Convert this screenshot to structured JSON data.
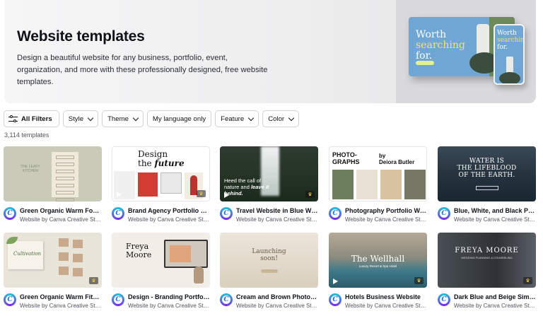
{
  "hero": {
    "title": "Website templates",
    "description": "Design a beautiful website for any business, portfolio, event, organization, and more with these professionally designed, free website templates.",
    "mock_headline_line1": "Worth",
    "mock_headline_line2": "searching",
    "mock_headline_line3": "for."
  },
  "filters": {
    "all_label": "All Filters",
    "style": "Style",
    "theme": "Theme",
    "language": "My language only",
    "feature": "Feature",
    "color": "Color"
  },
  "result_count": "3,114 templates",
  "templates": [
    {
      "title": "Green Organic Warm Food ...",
      "author": "Website by Canva Creative Stud...",
      "thumb_text": "THE LEAFY KITCHEN",
      "premium": false,
      "video": false
    },
    {
      "title": "Brand Agency Portfolio W...",
      "author": "Website by Canva Creative Stud...",
      "thumb_text_1": "Design",
      "thumb_text_2": "the",
      "thumb_text_3": "future",
      "premium": true,
      "video": true
    },
    {
      "title": "Travel Website in Blue Whi...",
      "author": "Website by Canva Creative Stud...",
      "thumb_text_1": "Heed the call of",
      "thumb_text_2": "nature and",
      "thumb_text_3": "leave it",
      "thumb_text_4": "behind.",
      "premium": true,
      "video": true
    },
    {
      "title": "Photography Portfolio We...",
      "author": "Website by Canva Creative Stud...",
      "thumb_text_1": "PHOTO-",
      "thumb_text_2": "GRAPHS",
      "thumb_text_3": "by",
      "thumb_text_4": "Deiora Butler",
      "premium": false,
      "video": false
    },
    {
      "title": "Blue, White, and Black Pho...",
      "author": "Website by Canva Creative Stud...",
      "thumb_text_1": "WATER IS",
      "thumb_text_2": "THE LIFEBLOOD",
      "thumb_text_3": "OF THE EARTH.",
      "premium": false,
      "video": false
    },
    {
      "title": "Green Organic Warm Fitne...",
      "author": "Website by Canva Creative Stud...",
      "thumb_text": "Cultivation",
      "premium": true,
      "video": false
    },
    {
      "title": "Design - Branding Portfoli...",
      "author": "Website by Canva Creative Stud...",
      "thumb_text_1": "Freya",
      "thumb_text_2": "Moore",
      "premium": false,
      "video": false
    },
    {
      "title": "Cream and Brown Photogr...",
      "author": "Website by Canva Creative Stud...",
      "thumb_text_1": "Launching",
      "thumb_text_2": "soon!",
      "premium": false,
      "video": false
    },
    {
      "title": "Hotels Business Website",
      "author": "Website by Canva Creative Stud...",
      "thumb_text_1": "The Wellhall",
      "thumb_text_2": "Luxury Resort & Spa Hotel",
      "premium": true,
      "video": true
    },
    {
      "title": "Dark Blue and Beige Simpl...",
      "author": "Website by Canva Creative Stud...",
      "thumb_text_1": "FREYA MOORE",
      "thumb_text_2": "WEDDING PLANNING & COUNSELING",
      "premium": true,
      "video": false
    }
  ],
  "colors": {
    "accent_canva_teal": "#1fc4d6",
    "accent_canva_purple": "#7d2ae8",
    "premium_crown": "#f7c948"
  },
  "icons": {
    "filter": "sliders-icon",
    "dropdown": "chevron-down-icon",
    "premium": "crown-icon",
    "video": "play-icon",
    "author": "canva-logo-icon"
  }
}
